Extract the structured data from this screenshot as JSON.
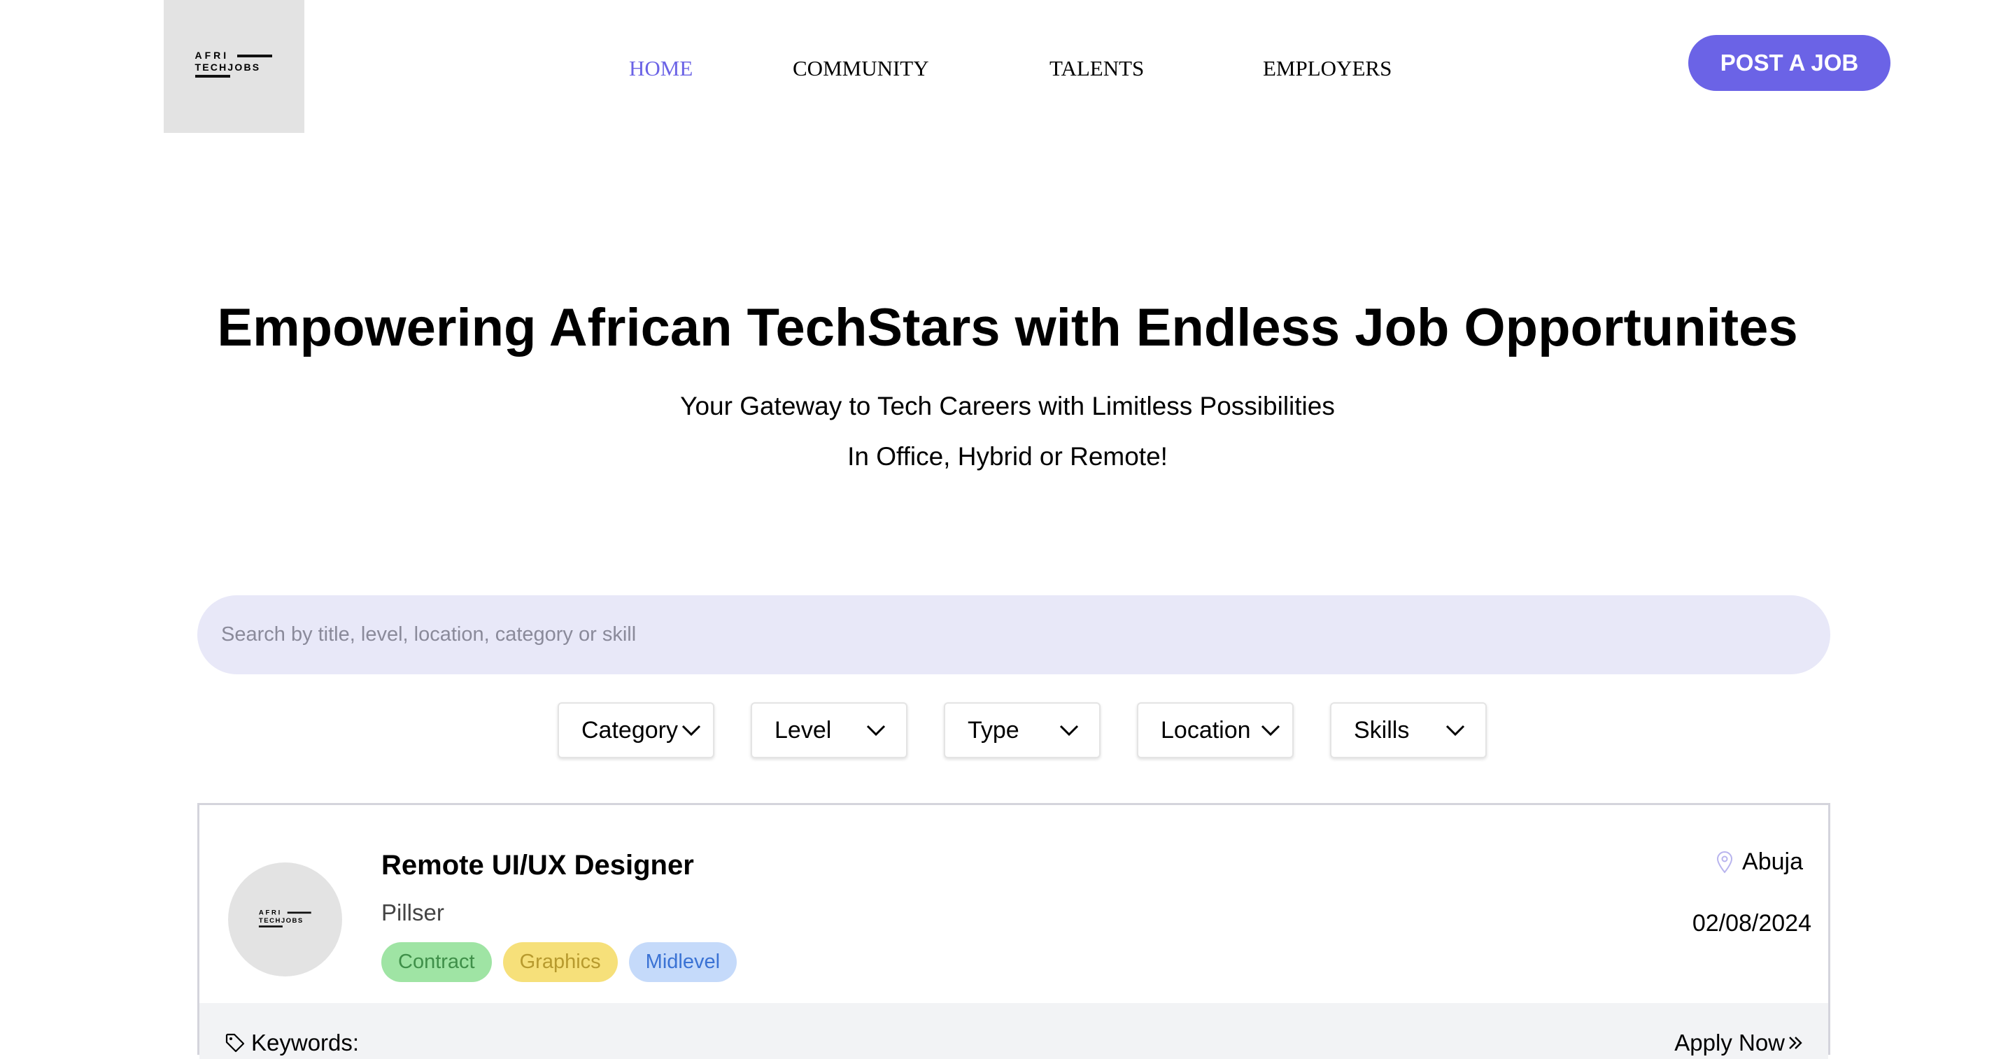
{
  "logo": {
    "line1": "AFRI",
    "line2": "TECHJOBS"
  },
  "nav": {
    "items": [
      {
        "label": "HOME",
        "active": true
      },
      {
        "label": "COMMUNITY",
        "active": false
      },
      {
        "label": "TALENTS",
        "active": false
      },
      {
        "label": "EMPLOYERS",
        "active": false
      }
    ],
    "post_job": "POST A JOB"
  },
  "hero": {
    "title": "Empowering African TechStars with Endless Job Opportunites",
    "subtitle1": "Your Gateway to Tech Careers with Limitless Possibilities",
    "subtitle2": "In Office, Hybrid or Remote!"
  },
  "search": {
    "placeholder": "Search by title, level, location, category or skill"
  },
  "filters": [
    "Category",
    "Level",
    "Type",
    "Location",
    "Skills"
  ],
  "job": {
    "title": "Remote UI/UX Designer",
    "company": "Pillser",
    "tags": [
      "Contract",
      "Graphics",
      "Midlevel"
    ],
    "location": "Abuja",
    "date": "02/08/2024",
    "keywords_label": "Keywords:",
    "apply_label": "Apply Now"
  },
  "colors": {
    "accent": "#6b63e6",
    "search_bg": "#e8e8f8"
  }
}
